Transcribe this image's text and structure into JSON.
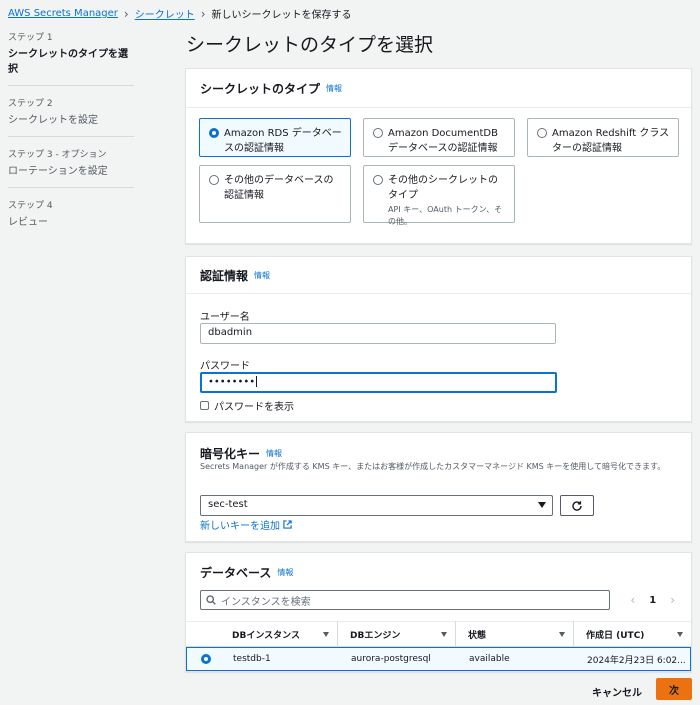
{
  "breadcrumb": {
    "items": [
      "AWS Secrets Manager",
      "シークレット"
    ],
    "current": "新しいシークレットを保存する"
  },
  "steps": [
    {
      "num": "ステップ 1",
      "label": "シークレットのタイプを選択",
      "active": true
    },
    {
      "num": "ステップ 2",
      "label": "シークレットを設定",
      "active": false
    },
    {
      "num": "ステップ 3 - オプション",
      "label": "ローテーションを設定",
      "active": false
    },
    {
      "num": "ステップ 4",
      "label": "レビュー",
      "active": false
    }
  ],
  "page_title": "シークレットのタイプを選択",
  "secret_type": {
    "heading": "シークレットのタイプ",
    "info": "情報",
    "options": [
      {
        "label": "Amazon RDS データベースの認証情報",
        "selected": true
      },
      {
        "label": "Amazon DocumentDB データベースの認証情報",
        "selected": false
      },
      {
        "label": "Amazon Redshift クラスターの認証情報",
        "selected": false
      },
      {
        "label": "その他のデータベースの認証情報",
        "selected": false
      },
      {
        "label": "その他のシークレットのタイプ",
        "sub": "API キー、OAuth トークン、その他。",
        "selected": false
      }
    ]
  },
  "credentials": {
    "heading": "認証情報",
    "info": "情報",
    "username_label": "ユーザー名",
    "username_value": "dbadmin",
    "password_label": "パスワード",
    "password_value": "••••••••",
    "show_password_label": "パスワードを表示"
  },
  "encryption": {
    "heading": "暗号化キー",
    "info": "情報",
    "description": "Secrets Manager が作成する KMS キー、またはお客様が作成したカスタマーマネージド KMS キーを使用して暗号化できます。",
    "selected_key": "sec-test",
    "new_key_link": "新しいキーを追加"
  },
  "database": {
    "heading": "データベース",
    "info": "情報",
    "search_placeholder": "インスタンスを検索",
    "page": "1",
    "columns": [
      "DBインスタンス",
      "DBエンジン",
      "状態",
      "作成日 (UTC)"
    ],
    "rows": [
      {
        "instance": "testdb-1",
        "engine": "aurora-postgresql",
        "status": "available",
        "created": "2024年2月23日 6:02..."
      }
    ]
  },
  "footer": {
    "cancel_label": "キャンセル",
    "next_label": "次"
  },
  "colors": {
    "link": "#0972d3",
    "primary_button": "#ec7211",
    "background": "#f2f3f3"
  }
}
